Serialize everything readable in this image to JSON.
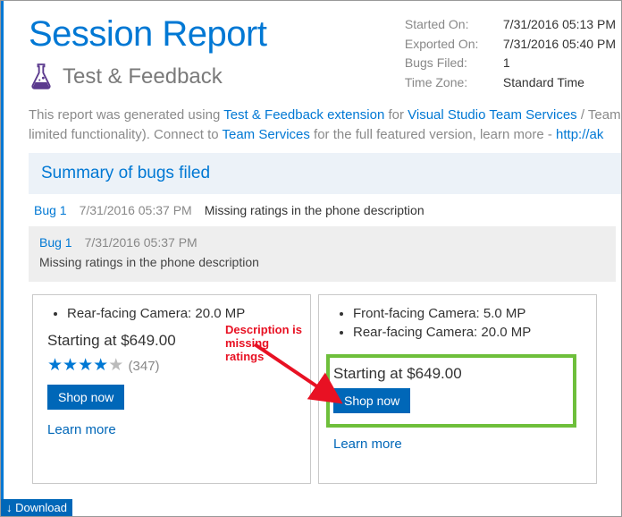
{
  "header": {
    "title": "Session Report",
    "subtitle": "Test & Feedback"
  },
  "meta": {
    "started_label": "Started On:",
    "started_val": "7/31/2016 05:13 PM",
    "exported_label": "Exported On:",
    "exported_val": "7/31/2016 05:40 PM",
    "bugs_label": "Bugs Filed:",
    "bugs_val": "1",
    "tz_label": "Time Zone:",
    "tz_val": "Standard Time"
  },
  "intro": {
    "pre": "This report was generated using ",
    "ext": "Test & Feedback extension",
    "mid1": " for ",
    "vsts": "Visual Studio Team Services",
    "tail1": " / Team",
    "line2a": "limited functionality). Connect to ",
    "ts": "Team Services",
    "line2b": " for the full featured version, learn more - ",
    "url": "http://ak"
  },
  "summary_heading": "Summary of bugs filed",
  "bug": {
    "id": "Bug 1",
    "time": "7/31/2016 05:37 PM",
    "title": "Missing ratings in the phone description"
  },
  "cards": {
    "left": {
      "feat1": "Rear-facing Camera: 20.0 MP",
      "price": "Starting at $649.00",
      "count": "(347)",
      "shop": "Shop now",
      "learn": "Learn more"
    },
    "right": {
      "feat1": "Front-facing Camera: 5.0 MP",
      "feat2": "Rear-facing Camera: 20.0 MP",
      "price": "Starting at $649.00",
      "shop": "Shop now",
      "learn": "Learn more"
    },
    "annotation": "Description is missing\nratings"
  },
  "download": "Download"
}
